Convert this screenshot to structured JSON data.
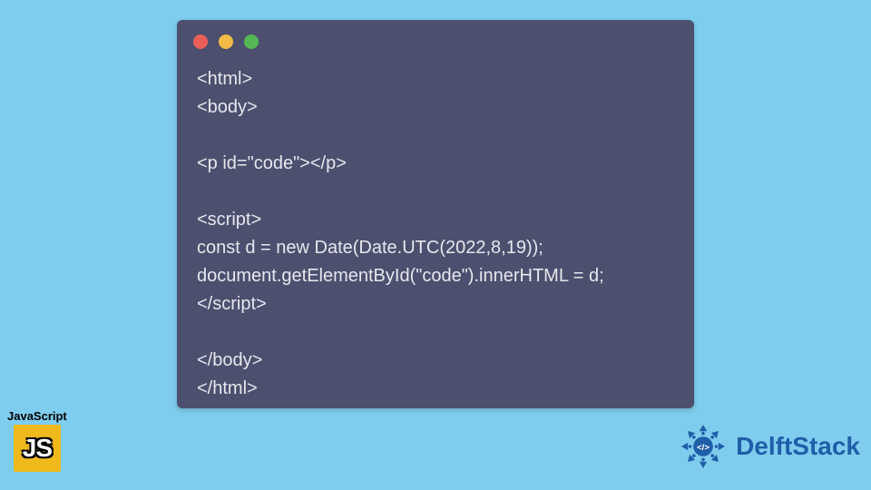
{
  "code": {
    "lines": [
      "<html>",
      "<body>",
      "",
      "<p id=\"code\"></p>",
      "",
      "<script>",
      "const d = new Date(Date.UTC(2022,8,19));",
      "document.getElementById(\"code\").innerHTML = d;",
      "</script>",
      "",
      "</body>",
      "</html>"
    ]
  },
  "js_logo": {
    "label": "JavaScript",
    "short": "JS"
  },
  "brand": {
    "name": "DelftStack"
  },
  "colors": {
    "page_bg": "#7fcdee",
    "window_bg": "#4c506e",
    "code_text": "#e6e7ee",
    "dot_red": "#ec5f59",
    "dot_yellow": "#f1bb46",
    "dot_green": "#55b855",
    "js_bg": "#f0b91b",
    "brand_blue": "#1f5ea8"
  }
}
